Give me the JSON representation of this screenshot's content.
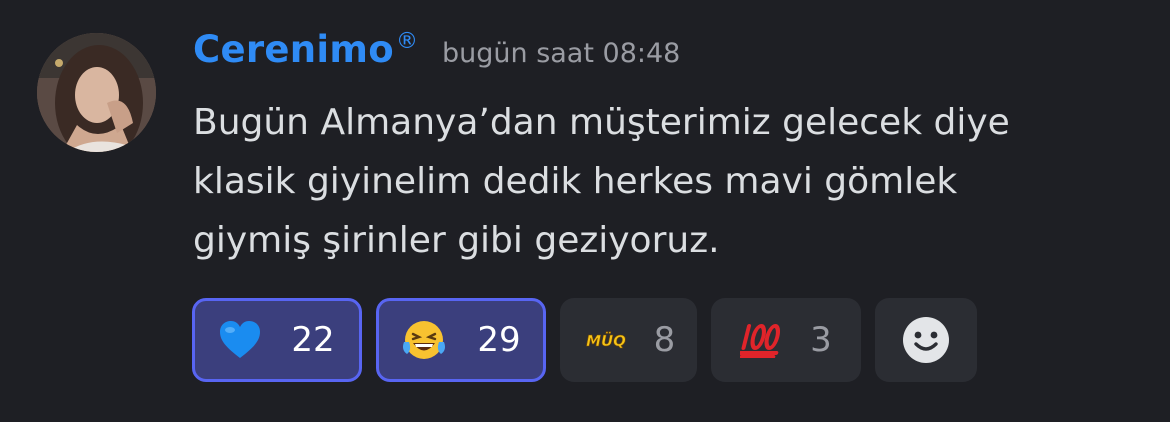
{
  "message": {
    "author": "Cerenimo",
    "author_mark": "®",
    "timestamp": "bugün saat 08:48",
    "lines": [
      "Bugün Almanya’dan müşterimiz gelecek diye",
      "klasik giyinelim dedik herkes mavi gömlek",
      "giymiş şirinler gibi geziyoruz."
    ]
  },
  "reactions": [
    {
      "icon": "blue-heart-icon",
      "count": "22",
      "active": true
    },
    {
      "icon": "laughing-tears-icon",
      "count": "29",
      "active": true
    },
    {
      "icon": "muq-emoji-icon",
      "emoji_text": "MÜQ",
      "count": "8",
      "active": false
    },
    {
      "icon": "hundred-points-icon",
      "count": "3",
      "active": false
    },
    {
      "icon": "add-reaction-smiley-icon"
    }
  ],
  "colors": {
    "background": "#1e1f24",
    "username": "#2f8bf5",
    "timestamp": "#9a9ca3",
    "text": "#dbdee1",
    "reaction_active_bg": "#3b3f7d",
    "reaction_active_border": "#5865f2",
    "reaction_bg": "#2b2d33"
  }
}
